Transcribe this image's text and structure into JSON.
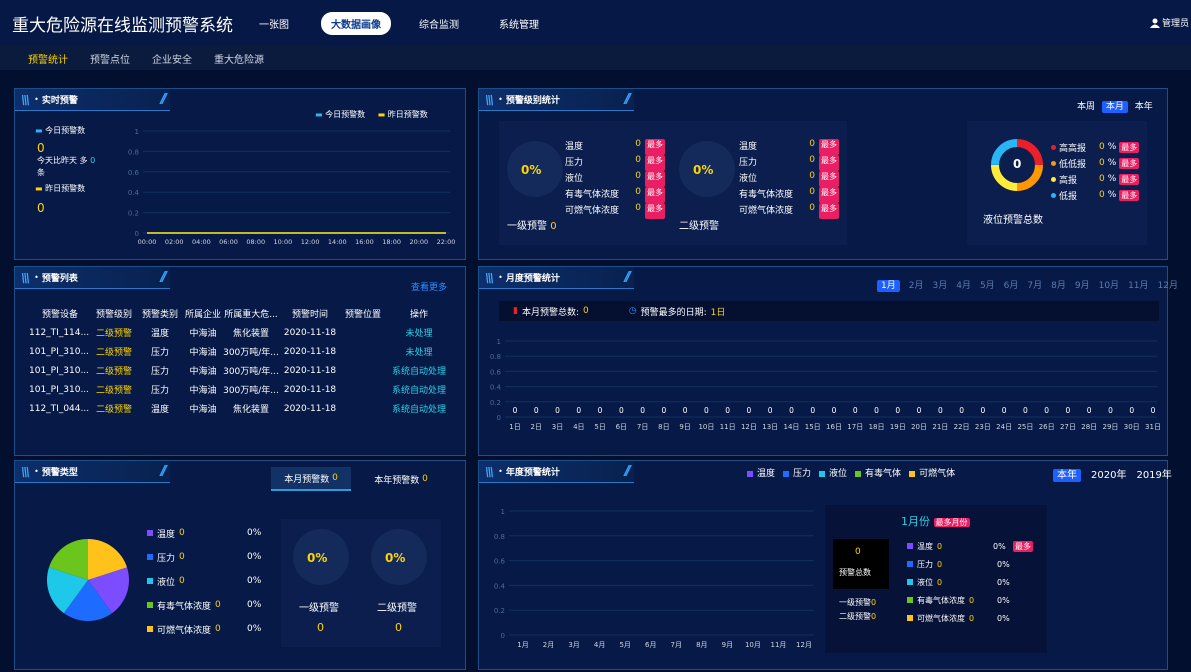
{
  "header": {
    "title": "重大危险源在线监测预警系统",
    "nav": [
      "一张图",
      "大数据画像",
      "综合监测",
      "系统管理"
    ],
    "user": "管理员"
  },
  "subnav": [
    "预警统计",
    "预警点位",
    "企业安全",
    "重大危险源"
  ],
  "realtime": {
    "title": "实时预警",
    "legend_today": "今日预警数",
    "legend_yest": "昨日预警数",
    "today_label": "今日预警数",
    "today_value": "0",
    "compare": "今天比昨天 多",
    "compare_value": "0",
    "compare_unit": "条",
    "yest_label": "昨日预警数",
    "yest_value": "0",
    "yticks": [
      "1",
      "0.8",
      "0.6",
      "0.4",
      "0.2",
      "0"
    ],
    "xticks": [
      "00:00",
      "02:00",
      "04:00",
      "06:00",
      "08:00",
      "10:00",
      "12:00",
      "14:00",
      "16:00",
      "18:00",
      "20:00",
      "22:00"
    ]
  },
  "level": {
    "title": "预警级别统计",
    "tabs": [
      "本周",
      "本月",
      "本年"
    ],
    "selected_tab": "本月",
    "lv1": {
      "pct": "0%",
      "label": "一级预警",
      "value": "0"
    },
    "lv2": {
      "pct": "0%",
      "label": "二级预警",
      "value": "0"
    },
    "cats": [
      "温度",
      "压力",
      "液位",
      "有毒气体浓度",
      "可燃气体浓度"
    ],
    "cat_value": "0",
    "most": "最多",
    "ring": {
      "value": "0",
      "label": "液位预警总数",
      "items": [
        "高高报",
        "低低报",
        "高报",
        "低报"
      ],
      "colors": [
        "#e8202a",
        "#ff9800",
        "#ffeb3b",
        "#29b6f6"
      ],
      "pct_value": "0",
      "pct_unit": "%"
    }
  },
  "list": {
    "title": "预警列表",
    "more": "查看更多",
    "headers": [
      "预警设备",
      "预警级别",
      "预警类别",
      "所属企业",
      "所属重大危...",
      "预警时间",
      "预警位置",
      "操作"
    ],
    "rows": [
      [
        "112_TI_114...",
        "二级预警",
        "温度",
        "中海油",
        "焦化装置",
        "2020-11-18",
        "",
        "未处理"
      ],
      [
        "101_PI_310...",
        "二级预警",
        "压力",
        "中海油",
        "300万吨/年...",
        "2020-11-18",
        "",
        "未处理"
      ],
      [
        "101_PI_310...",
        "二级预警",
        "压力",
        "中海油",
        "300万吨/年...",
        "2020-11-18",
        "",
        "系统自动处理"
      ],
      [
        "101_PI_310...",
        "二级预警",
        "压力",
        "中海油",
        "300万吨/年...",
        "2020-11-18",
        "",
        "系统自动处理"
      ],
      [
        "112_TI_044...",
        "二级预警",
        "温度",
        "中海油",
        "焦化装置",
        "2020-11-18",
        "",
        "系统自动处理"
      ]
    ]
  },
  "monthly": {
    "title": "月度预警统计",
    "months": [
      "1月",
      "2月",
      "3月",
      "4月",
      "5月",
      "6月",
      "7月",
      "8月",
      "9月",
      "10月",
      "11月",
      "12月"
    ],
    "selected_month": "1月",
    "total_label": "本月预警总数:",
    "total_value": "0",
    "maxday_label": "预警最多的日期:",
    "maxday_value": "1日",
    "yticks": [
      "1",
      "0.8",
      "0.6",
      "0.4",
      "0.2",
      "0"
    ]
  },
  "types": {
    "title": "预警类型",
    "tab_month": "本月预警数",
    "tab_month_value": "0",
    "tab_year": "本年预警数",
    "tab_year_value": "0",
    "items": [
      {
        "name": "温度",
        "value": "0",
        "pct": "0%",
        "color": "#7c4dff"
      },
      {
        "name": "压力",
        "value": "0",
        "pct": "0%",
        "color": "#1e6bff"
      },
      {
        "name": "液位",
        "value": "0",
        "pct": "0%",
        "color": "#1ec8e8"
      },
      {
        "name": "有毒气体浓度",
        "value": "0",
        "pct": "0%",
        "color": "#6cc51c"
      },
      {
        "name": "可燃气体浓度",
        "value": "0",
        "pct": "0%",
        "color": "#ffc21a"
      }
    ],
    "lv1": {
      "pct": "0%",
      "label": "一级预警",
      "value": "0"
    },
    "lv2": {
      "pct": "0%",
      "label": "二级预警",
      "value": "0"
    }
  },
  "yearly": {
    "title": "年度预警统计",
    "legend": [
      {
        "name": "温度",
        "color": "#7c4dff"
      },
      {
        "name": "压力",
        "color": "#1e6bff"
      },
      {
        "name": "液位",
        "color": "#1ec8e8"
      },
      {
        "name": "有毒气体",
        "color": "#6cc51c"
      },
      {
        "name": "可燃气体",
        "color": "#ffc21a"
      }
    ],
    "years": [
      "本年",
      "2020年",
      "2019年"
    ],
    "selected_year": "本年",
    "yticks": [
      "1",
      "0.8",
      "0.6",
      "0.4",
      "0.2",
      "0"
    ],
    "months": [
      "1月",
      "2月",
      "3月",
      "4月",
      "5月",
      "6月",
      "7月",
      "8月",
      "9月",
      "10月",
      "11月",
      "12月"
    ],
    "tip": {
      "month": "1月份",
      "most": "最多月份",
      "total": "0",
      "total_label": "预警总数",
      "lv1_label": "一级预警",
      "lv1": "0",
      "lv2_label": "二级预警",
      "lv2": "0",
      "items": [
        {
          "name": "温度",
          "value": "0",
          "pct": "0%",
          "most": "最多"
        },
        {
          "name": "压力",
          "value": "0",
          "pct": "0%"
        },
        {
          "name": "液位",
          "value": "0",
          "pct": "0%"
        },
        {
          "name": "有毒气体浓度",
          "value": "0",
          "pct": "0%"
        },
        {
          "name": "可燃气体浓度",
          "value": "0",
          "pct": "0%"
        }
      ]
    }
  },
  "chart_data": [
    {
      "type": "line",
      "title": "实时预警",
      "x": [
        "00:00",
        "02:00",
        "04:00",
        "06:00",
        "08:00",
        "10:00",
        "12:00",
        "14:00",
        "16:00",
        "18:00",
        "20:00",
        "22:00"
      ],
      "series": [
        {
          "name": "今日预警数",
          "values": [
            0,
            0,
            0,
            0,
            0,
            0,
            0,
            0,
            0,
            0,
            0,
            0
          ]
        },
        {
          "name": "昨日预警数",
          "values": [
            0,
            0,
            0,
            0,
            0,
            0,
            0,
            0,
            0,
            0,
            0,
            0
          ]
        }
      ],
      "ylim": [
        0,
        1
      ]
    },
    {
      "type": "bar",
      "title": "月度预警统计",
      "categories": [
        "1日",
        "2日",
        "3日",
        "4日",
        "5日",
        "6日",
        "7日",
        "8日",
        "9日",
        "10日",
        "11日",
        "12日",
        "13日",
        "14日",
        "15日",
        "16日",
        "17日",
        "18日",
        "19日",
        "20日",
        "21日",
        "22日",
        "23日",
        "24日",
        "25日",
        "26日",
        "27日",
        "28日",
        "29日",
        "30日",
        "31日"
      ],
      "values": [
        0,
        0,
        0,
        0,
        0,
        0,
        0,
        0,
        0,
        0,
        0,
        0,
        0,
        0,
        0,
        0,
        0,
        0,
        0,
        0,
        0,
        0,
        0,
        0,
        0,
        0,
        0,
        0,
        0,
        0,
        0
      ],
      "ylim": [
        0,
        1
      ]
    },
    {
      "type": "pie",
      "title": "预警类型",
      "categories": [
        "温度",
        "压力",
        "液位",
        "有毒气体浓度",
        "可燃气体浓度"
      ],
      "values": [
        0,
        0,
        0,
        0,
        0
      ]
    },
    {
      "type": "bar",
      "title": "年度预警统计",
      "categories": [
        "1月",
        "2月",
        "3月",
        "4月",
        "5月",
        "6月",
        "7月",
        "8月",
        "9月",
        "10月",
        "11月",
        "12月"
      ],
      "series": [
        {
          "name": "温度",
          "values": [
            0,
            0,
            0,
            0,
            0,
            0,
            0,
            0,
            0,
            0,
            0,
            0
          ]
        },
        {
          "name": "压力",
          "values": [
            0,
            0,
            0,
            0,
            0,
            0,
            0,
            0,
            0,
            0,
            0,
            0
          ]
        },
        {
          "name": "液位",
          "values": [
            0,
            0,
            0,
            0,
            0,
            0,
            0,
            0,
            0,
            0,
            0,
            0
          ]
        },
        {
          "name": "有毒气体",
          "values": [
            0,
            0,
            0,
            0,
            0,
            0,
            0,
            0,
            0,
            0,
            0,
            0
          ]
        },
        {
          "name": "可燃气体",
          "values": [
            0,
            0,
            0,
            0,
            0,
            0,
            0,
            0,
            0,
            0,
            0,
            0
          ]
        }
      ],
      "ylim": [
        0,
        1
      ]
    }
  ]
}
